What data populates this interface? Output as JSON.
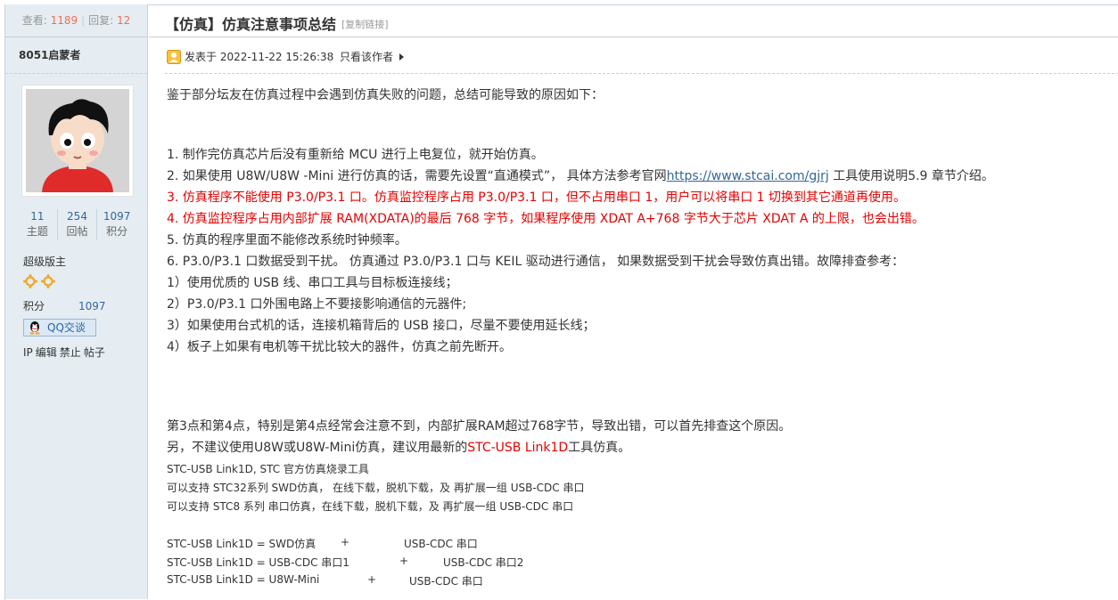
{
  "sidebar": {
    "views_label": "查看:",
    "views": "1189",
    "replies_label": "回复:",
    "replies": "12",
    "author": "8051启蒙者",
    "counts": [
      {
        "value": "11",
        "label": "主题"
      },
      {
        "value": "254",
        "label": "回帖"
      },
      {
        "value": "1097",
        "label": "积分"
      }
    ],
    "rank": "超级版主",
    "credit_label": "积分",
    "credit_value": "1097",
    "qq_label": "QQ交谈",
    "admin_links": [
      "IP",
      "编辑",
      "禁止",
      "帖子"
    ]
  },
  "post": {
    "title": "【仿真】仿真注意事项总结",
    "copy_link": "[复制链接]",
    "posted": "发表于 2022-11-22 15:26:38",
    "separator": "|",
    "only_author": "只看该作者",
    "intro": "鉴于部分坛友在仿真过程中会遇到仿真失败的问题，总结可能导致的原因如下：",
    "item1": "1.  制作完仿真芯片后没有重新给 MCU 进行上电复位，就开始仿真。",
    "item2_pre": "2.  如果使用 U8W/U8W -Mini 进行仿真的话，需要先设置“直通模式”， 具体方法参考官网",
    "item2_link": "https://www.stcai.com/gjrj",
    "item2_post": " 工具使用说明5.9 章节介绍。",
    "item3": "3.  仿真程序不能使用 P3.0/P3.1 口。仿真监控程序占用 P3.0/P3.1 口，但不占用串口 1，用户可以将串口 1 切换到其它通道再使用。",
    "item4": "4.  仿真监控程序占用内部扩展 RAM(XDATA)的最后 768 字节，如果程序使用 XDAT A+768 字节大于芯片 XDAT A 的上限，也会出错。",
    "item5": "5.  仿真的程序里面不能修改系统时钟频率。",
    "item6": "6.  P3.0/P3.1 口数据受到干扰。 仿真通过 P3.0/P3.1 口与 KEIL 驱动进行通信， 如果数据受到干扰会导致仿真出错。故障排查参考：",
    "sub1": "1）使用优质的 USB 线、串口工具与目标板连接线；",
    "sub2": "2）P3.0/P3.1 口外围电路上不要接影响通信的元器件;",
    "sub3": "3）如果使用台式机的话，连接机箱背后的 USB 接口，尽量不要使用延长线；",
    "sub4": "4）板子上如果有电机等干扰比较大的器件，仿真之前先断开。",
    "note1": "第3点和第4点，特别是第4点经常会注意不到，内部扩展RAM超过768字节，导致出错，可以首先排查这个原因。",
    "note2_pre": "另，不建议使用U8W或U8W-Mini仿真，建议用最新的",
    "note2_red": "STC-USB Link1D",
    "note2_post": "工具仿真。",
    "small1": "STC-USB Link1D, STC 官方仿真烧录工具",
    "small2": "可以支持 STC32系列 SWD仿真， 在线下载，脱机下载，及 再扩展一组 USB-CDC 串口",
    "small3": "可以支持 STC8 系列 串口仿真，在线下载，脱机下载，及 再扩展一组 USB-CDC 串口",
    "t1a": "STC-USB Link1D  = SWD仿真",
    "t1b": "+",
    "t1c": "USB-CDC 串口",
    "t2a": "STC-USB Link1D  = USB-CDC 串口1",
    "t2b": "+",
    "t2c": "USB-CDC 串口2",
    "t3a": "STC-USB Link1D  = U8W-Mini",
    "t3b": "+",
    "t3c": "USB-CDC 串口"
  }
}
